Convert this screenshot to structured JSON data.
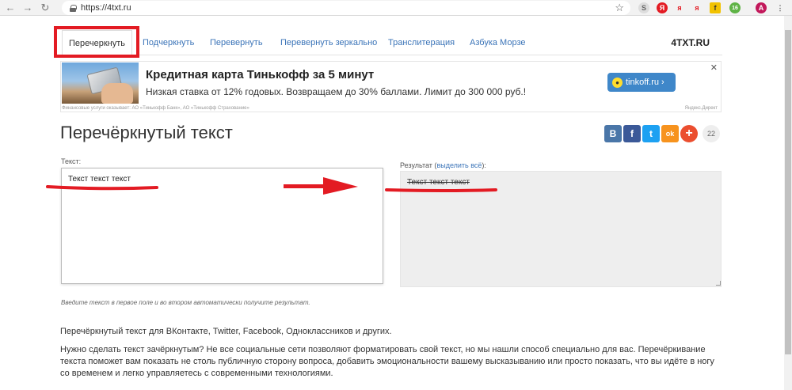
{
  "browser": {
    "url": "https://4txt.ru",
    "ext_badge": "16",
    "profile_initial": "A"
  },
  "nav": {
    "items": [
      {
        "label": "Перечеркнуть"
      },
      {
        "label": "Подчеркнуть"
      },
      {
        "label": "Перевернуть"
      },
      {
        "label": "Перевернуть зеркально"
      },
      {
        "label": "Транслитерация"
      },
      {
        "label": "Азбука Морзе"
      }
    ],
    "brand": "4TXT.RU"
  },
  "ad": {
    "title": "Кредитная карта Тинькофф за 5 минут",
    "text": "Низкая ставка от 12% годовых. Возвращаем до 30% баллами. Лимит до 300 000 руб.!",
    "button": "tinkoff.ru ›",
    "close": "✕",
    "footer": "Финансовые услуги оказывает: АО «Тинькофф Банк», АО «Тинькофф Страхование»",
    "footer_right": "Яндекс.Директ"
  },
  "page": {
    "title": "Перечёркнутый текст",
    "share_count": "22",
    "share_labels": [
      "В",
      "f",
      "t",
      "ok",
      "+"
    ]
  },
  "form": {
    "input_label": "Текст:",
    "input_value": "Текст текст текст",
    "output_label": "Результат (",
    "output_link": "выделить всё",
    "output_label_end": "):",
    "output_value": "Текст текст текст",
    "hint": "Введите текст в первое поле и во втором автоматически получите результат."
  },
  "content": {
    "p1": "Перечёркнутый текст для ВКонтакте, Twitter, Facebook, Одноклассников и других.",
    "p2": "Нужно сделать текст зачёркнутым? Не все социальные сети позволяют форматировать свой текст, но мы нашли способ специально для вас. Перечёркивание текста поможет вам показать не столь публичную сторону вопроса, добавить эмоциональности вашему высказыванию или просто показать, что вы идёте в ногу со временем и легко управляетесь с современными технологиями."
  },
  "colors": {
    "link": "#3b74b8",
    "annotation": "#e31b23",
    "vk": "#4a76a8",
    "facebook": "#3b5998",
    "twitter": "#1da1f2",
    "ok": "#f7931e",
    "plus": "#eb4e2f"
  }
}
